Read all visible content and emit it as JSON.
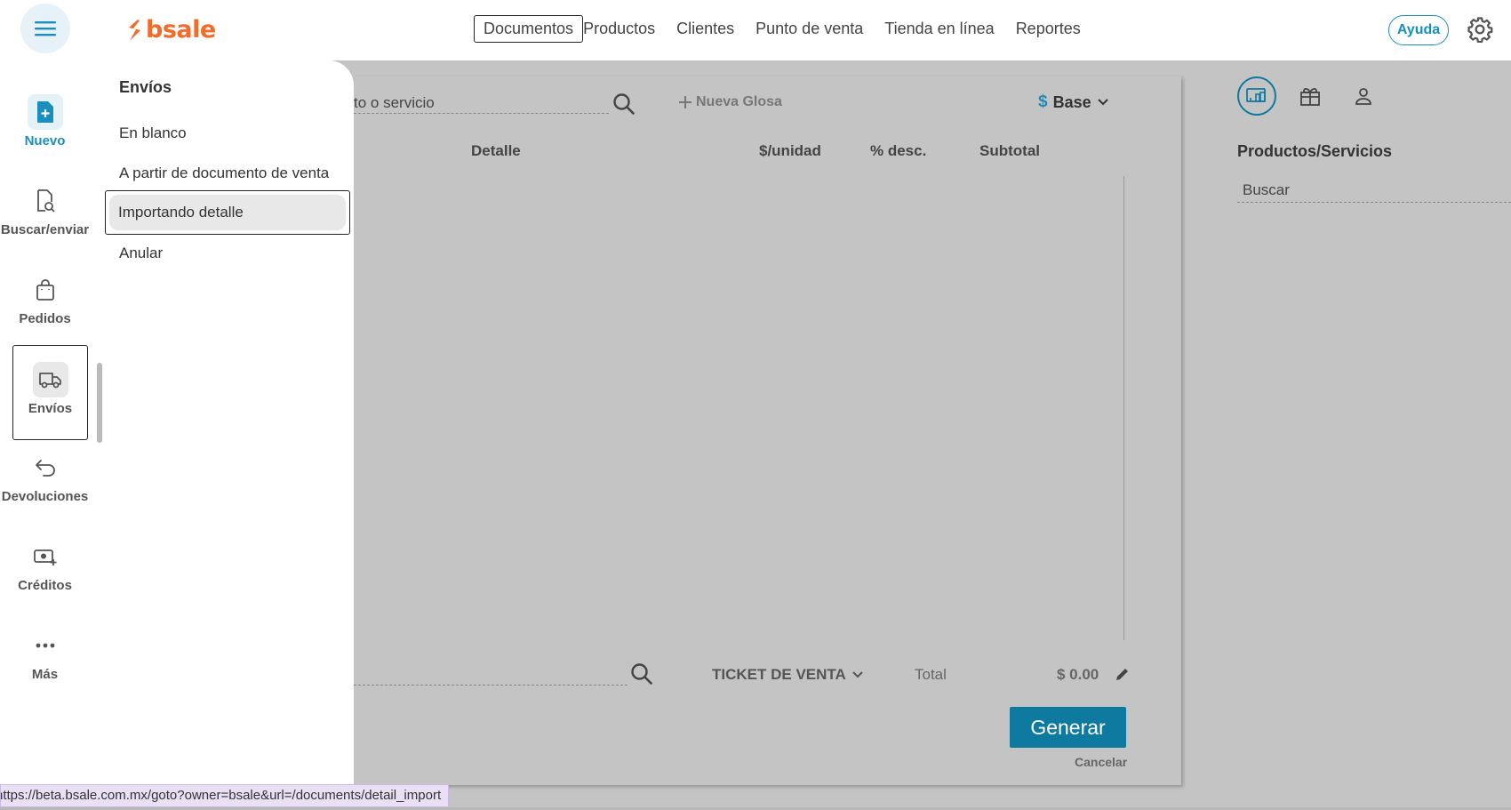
{
  "app": {
    "logo": "bsale"
  },
  "topnav": {
    "items": [
      "Documentos",
      "Productos",
      "Clientes",
      "Punto de venta",
      "Tienda en línea",
      "Reportes"
    ],
    "help": "Ayuda"
  },
  "rail": {
    "items": [
      {
        "label": "Nuevo",
        "icon": "new-document-icon"
      },
      {
        "label": "Buscar/enviar",
        "icon": "document-search-icon"
      },
      {
        "label": "Pedidos",
        "icon": "shopping-bag-icon"
      },
      {
        "label": "Envíos",
        "icon": "truck-icon"
      },
      {
        "label": "Devoluciones",
        "icon": "return-arrow-icon"
      },
      {
        "label": "Créditos",
        "icon": "cash-plus-icon"
      },
      {
        "label": "Más",
        "icon": "more-dots-icon"
      }
    ]
  },
  "flyout": {
    "title": "Envíos",
    "items": [
      "En blanco",
      "A partir de documento de venta",
      "Importando detalle",
      "Anular"
    ]
  },
  "doc": {
    "search_placeholder_visible": "to o servicio",
    "new_gloss": "Nueva Glosa",
    "price_list": "Base",
    "columns": {
      "detail": "Detalle",
      "unit_price": "$/unidad",
      "discount": "% desc.",
      "subtotal": "Subtotal"
    },
    "doc_type": "TICKET DE VENTA",
    "total_label": "Total",
    "total_value": "$ 0.00",
    "generate": "Generar",
    "cancel": "Cancelar"
  },
  "right": {
    "title": "Productos/Servicios",
    "search_placeholder": "Buscar"
  },
  "statusbar": {
    "url": "https://beta.bsale.com.mx/goto?owner=bsale&url=/documents/detail_import"
  },
  "colors": {
    "accent": "#1a8fbf",
    "brand": "#f26b2a",
    "primary_button": "#0e7aa0"
  }
}
